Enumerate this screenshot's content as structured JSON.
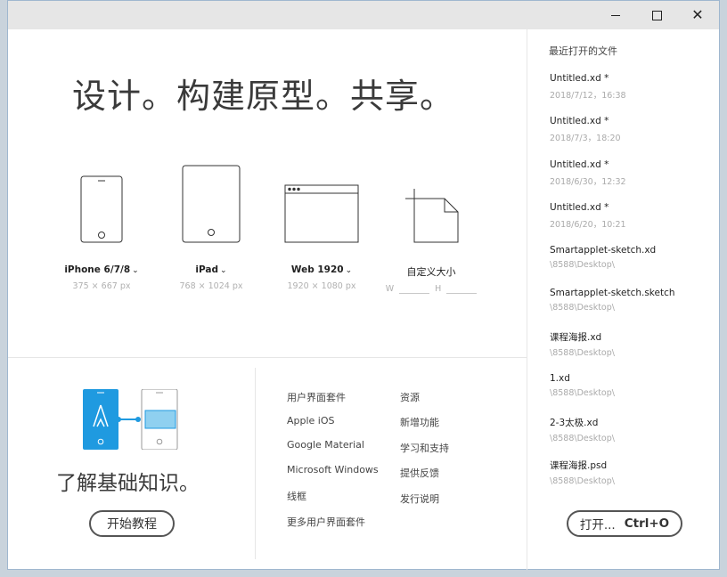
{
  "window": {
    "minimize_symbol": "",
    "close_symbol": "✕"
  },
  "headline": "设计。构建原型。共享。",
  "presets": [
    {
      "name": "iPhone 6/7/8",
      "size": "375 × 667 px",
      "icon": "phone-icon"
    },
    {
      "name": "iPad",
      "size": "768 × 1024 px",
      "icon": "tablet-icon"
    },
    {
      "name": "Web 1920",
      "size": "1920 × 1080 px",
      "icon": "browser-window-icon"
    }
  ],
  "custom": {
    "label": "自定义大小",
    "w_label": "W",
    "h_label": "H",
    "w_value": "",
    "h_value": ""
  },
  "learn": {
    "title": "了解基础知识。",
    "button": "开始教程"
  },
  "ui_kits": {
    "heading": "用户界面套件",
    "items": [
      "Apple iOS",
      "Google Material",
      "Microsoft Windows",
      "线框",
      "更多用户界面套件"
    ]
  },
  "resources": {
    "heading": "资源",
    "items": [
      "新增功能",
      "学习和支持",
      "提供反馈",
      "发行说明"
    ]
  },
  "recent": {
    "title": "最近打开的文件",
    "items": [
      {
        "name": "Untitled.xd *",
        "meta": "2018/7/12，16:38"
      },
      {
        "name": "Untitled.xd *",
        "meta": "2018/7/3，18:20"
      },
      {
        "name": "Untitled.xd *",
        "meta": "2018/6/30，12:32"
      },
      {
        "name": "Untitled.xd *",
        "meta": "2018/6/20，10:21"
      },
      {
        "name": "Smartapplet-sketch.xd",
        "meta": "\\8588\\Desktop\\"
      },
      {
        "name": "Smartapplet-sketch.sketch",
        "meta": "\\8588\\Desktop\\"
      },
      {
        "name": "课程海报.xd",
        "meta": "\\8588\\Desktop\\"
      },
      {
        "name": "1.xd",
        "meta": "\\8588\\Desktop\\"
      },
      {
        "name": "2-3太极.xd",
        "meta": "\\8588\\Desktop\\"
      },
      {
        "name": "课程海报.psd",
        "meta": "\\8588\\Desktop\\"
      }
    ],
    "open_button": "打开...",
    "open_shortcut": "Ctrl+O"
  },
  "colors": {
    "accent_blue": "#1f9ae0",
    "light_blue": "#8fd0f0"
  }
}
